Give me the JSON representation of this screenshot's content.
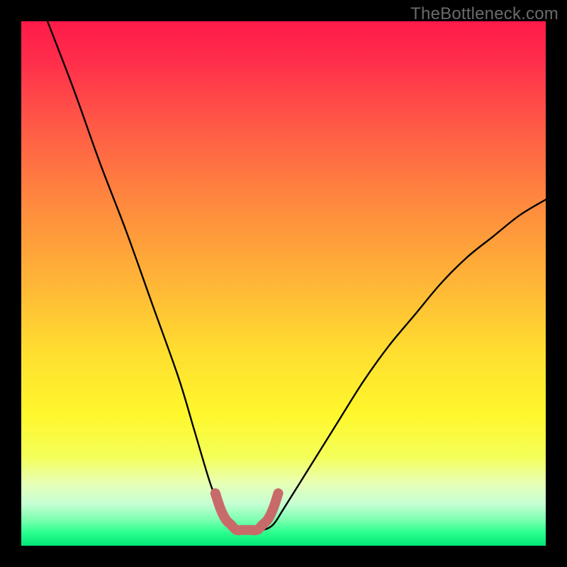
{
  "watermark": "TheBottleneck.com",
  "chart_data": {
    "type": "line",
    "title": "",
    "xlabel": "",
    "ylabel": "",
    "xlim": [
      0,
      100
    ],
    "ylim": [
      0,
      100
    ],
    "series": [
      {
        "name": "bottleneck-curve",
        "x": [
          5,
          10,
          15,
          20,
          25,
          30,
          33,
          36,
          38,
          40,
          42,
          44,
          46,
          48,
          50,
          55,
          60,
          65,
          70,
          75,
          80,
          85,
          90,
          95,
          100
        ],
        "y": [
          100,
          87,
          73,
          60,
          46,
          32,
          22,
          12,
          7,
          4,
          3,
          3,
          3,
          4,
          7,
          15,
          23,
          31,
          38,
          44,
          50,
          55,
          59,
          63,
          66
        ]
      },
      {
        "name": "optimal-marker",
        "x": [
          37,
          38,
          39,
          40,
          41,
          42,
          43,
          44,
          45,
          46,
          47,
          48,
          49
        ],
        "y": [
          10,
          7,
          5,
          4,
          3,
          3,
          3,
          3,
          3,
          4,
          5,
          7,
          10
        ]
      }
    ],
    "gradient_stops": [
      {
        "offset": 0.0,
        "color": "#ff1a49"
      },
      {
        "offset": 0.08,
        "color": "#ff2f4b"
      },
      {
        "offset": 0.2,
        "color": "#ff5a46"
      },
      {
        "offset": 0.35,
        "color": "#ff8a3e"
      },
      {
        "offset": 0.5,
        "color": "#ffb637"
      },
      {
        "offset": 0.63,
        "color": "#ffde30"
      },
      {
        "offset": 0.75,
        "color": "#fff72c"
      },
      {
        "offset": 0.83,
        "color": "#f4ff58"
      },
      {
        "offset": 0.88,
        "color": "#e8ffb4"
      },
      {
        "offset": 0.92,
        "color": "#c6ffd4"
      },
      {
        "offset": 0.95,
        "color": "#7dffb0"
      },
      {
        "offset": 0.975,
        "color": "#2cff8e"
      },
      {
        "offset": 1.0,
        "color": "#00e676"
      }
    ],
    "colors": {
      "curve": "#000000",
      "marker": "#c96a6a",
      "frame": "#000000"
    }
  }
}
